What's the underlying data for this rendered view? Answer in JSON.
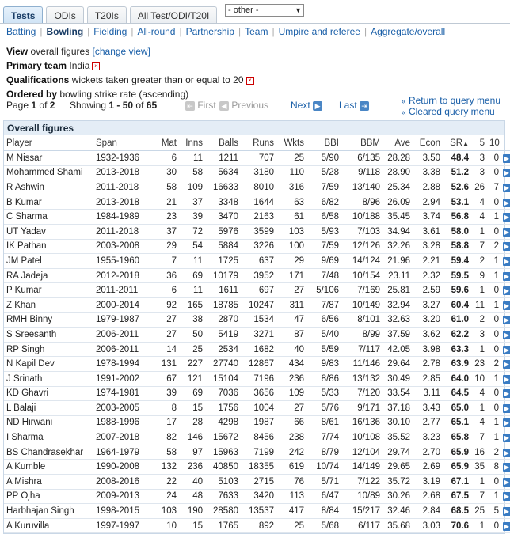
{
  "tabs": [
    {
      "label": "Tests",
      "active": true
    },
    {
      "label": "ODIs",
      "active": false
    },
    {
      "label": "T20Is",
      "active": false
    },
    {
      "label": "All Test/ODI/T20I",
      "active": false
    }
  ],
  "other_select": "- other -",
  "subnav": [
    {
      "label": "Batting",
      "active": false
    },
    {
      "label": "Bowling",
      "active": true
    },
    {
      "label": "Fielding",
      "active": false
    },
    {
      "label": "All-round",
      "active": false
    },
    {
      "label": "Partnership",
      "active": false
    },
    {
      "label": "Team",
      "active": false
    },
    {
      "label": "Umpire and referee",
      "active": false
    },
    {
      "label": "Aggregate/overall",
      "active": false
    }
  ],
  "info": {
    "view_label": "View",
    "view_value": "overall figures",
    "change_view": "[change view]",
    "primary_label": "Primary team",
    "primary_value": "India",
    "qual_label": "Qualifications",
    "qual_value": "wickets taken greater than or equal to 20",
    "order_label": "Ordered by",
    "order_value": "bowling strike rate (ascending)"
  },
  "pager": {
    "page_word": "Page",
    "page_num": "1",
    "of_word": "of",
    "page_total": "2",
    "showing_word": "Showing",
    "showing_range": "1 - 50",
    "showing_of": "of",
    "showing_total": "65",
    "first": "First",
    "previous": "Previous",
    "next": "Next",
    "last": "Last",
    "return_link": "Return to query menu",
    "cleared_link": "Cleared query menu"
  },
  "table": {
    "title": "Overall figures",
    "columns": [
      "Player",
      "Span",
      "Mat",
      "Inns",
      "Balls",
      "Runs",
      "Wkts",
      "BBI",
      "BBM",
      "Ave",
      "Econ",
      "SR",
      "5",
      "10"
    ],
    "rows": [
      [
        "M Nissar",
        "1932-1936",
        "6",
        "11",
        "1211",
        "707",
        "25",
        "5/90",
        "6/135",
        "28.28",
        "3.50",
        "48.4",
        "3",
        "0"
      ],
      [
        "Mohammed Shami",
        "2013-2018",
        "30",
        "58",
        "5634",
        "3180",
        "110",
        "5/28",
        "9/118",
        "28.90",
        "3.38",
        "51.2",
        "3",
        "0"
      ],
      [
        "R Ashwin",
        "2011-2018",
        "58",
        "109",
        "16633",
        "8010",
        "316",
        "7/59",
        "13/140",
        "25.34",
        "2.88",
        "52.6",
        "26",
        "7"
      ],
      [
        "B Kumar",
        "2013-2018",
        "21",
        "37",
        "3348",
        "1644",
        "63",
        "6/82",
        "8/96",
        "26.09",
        "2.94",
        "53.1",
        "4",
        "0"
      ],
      [
        "C Sharma",
        "1984-1989",
        "23",
        "39",
        "3470",
        "2163",
        "61",
        "6/58",
        "10/188",
        "35.45",
        "3.74",
        "56.8",
        "4",
        "1"
      ],
      [
        "UT Yadav",
        "2011-2018",
        "37",
        "72",
        "5976",
        "3599",
        "103",
        "5/93",
        "7/103",
        "34.94",
        "3.61",
        "58.0",
        "1",
        "0"
      ],
      [
        "IK Pathan",
        "2003-2008",
        "29",
        "54",
        "5884",
        "3226",
        "100",
        "7/59",
        "12/126",
        "32.26",
        "3.28",
        "58.8",
        "7",
        "2"
      ],
      [
        "JM Patel",
        "1955-1960",
        "7",
        "11",
        "1725",
        "637",
        "29",
        "9/69",
        "14/124",
        "21.96",
        "2.21",
        "59.4",
        "2",
        "1"
      ],
      [
        "RA Jadeja",
        "2012-2018",
        "36",
        "69",
        "10179",
        "3952",
        "171",
        "7/48",
        "10/154",
        "23.11",
        "2.32",
        "59.5",
        "9",
        "1"
      ],
      [
        "P Kumar",
        "2011-2011",
        "6",
        "11",
        "1611",
        "697",
        "27",
        "5/106",
        "7/169",
        "25.81",
        "2.59",
        "59.6",
        "1",
        "0"
      ],
      [
        "Z Khan",
        "2000-2014",
        "92",
        "165",
        "18785",
        "10247",
        "311",
        "7/87",
        "10/149",
        "32.94",
        "3.27",
        "60.4",
        "11",
        "1"
      ],
      [
        "RMH Binny",
        "1979-1987",
        "27",
        "38",
        "2870",
        "1534",
        "47",
        "6/56",
        "8/101",
        "32.63",
        "3.20",
        "61.0",
        "2",
        "0"
      ],
      [
        "S Sreesanth",
        "2006-2011",
        "27",
        "50",
        "5419",
        "3271",
        "87",
        "5/40",
        "8/99",
        "37.59",
        "3.62",
        "62.2",
        "3",
        "0"
      ],
      [
        "RP Singh",
        "2006-2011",
        "14",
        "25",
        "2534",
        "1682",
        "40",
        "5/59",
        "7/117",
        "42.05",
        "3.98",
        "63.3",
        "1",
        "0"
      ],
      [
        "N Kapil Dev",
        "1978-1994",
        "131",
        "227",
        "27740",
        "12867",
        "434",
        "9/83",
        "11/146",
        "29.64",
        "2.78",
        "63.9",
        "23",
        "2"
      ],
      [
        "J Srinath",
        "1991-2002",
        "67",
        "121",
        "15104",
        "7196",
        "236",
        "8/86",
        "13/132",
        "30.49",
        "2.85",
        "64.0",
        "10",
        "1"
      ],
      [
        "KD Ghavri",
        "1974-1981",
        "39",
        "69",
        "7036",
        "3656",
        "109",
        "5/33",
        "7/120",
        "33.54",
        "3.11",
        "64.5",
        "4",
        "0"
      ],
      [
        "L Balaji",
        "2003-2005",
        "8",
        "15",
        "1756",
        "1004",
        "27",
        "5/76",
        "9/171",
        "37.18",
        "3.43",
        "65.0",
        "1",
        "0"
      ],
      [
        "ND Hirwani",
        "1988-1996",
        "17",
        "28",
        "4298",
        "1987",
        "66",
        "8/61",
        "16/136",
        "30.10",
        "2.77",
        "65.1",
        "4",
        "1"
      ],
      [
        "I Sharma",
        "2007-2018",
        "82",
        "146",
        "15672",
        "8456",
        "238",
        "7/74",
        "10/108",
        "35.52",
        "3.23",
        "65.8",
        "7",
        "1"
      ],
      [
        "BS Chandrasekhar",
        "1964-1979",
        "58",
        "97",
        "15963",
        "7199",
        "242",
        "8/79",
        "12/104",
        "29.74",
        "2.70",
        "65.9",
        "16",
        "2"
      ],
      [
        "A Kumble",
        "1990-2008",
        "132",
        "236",
        "40850",
        "18355",
        "619",
        "10/74",
        "14/149",
        "29.65",
        "2.69",
        "65.9",
        "35",
        "8"
      ],
      [
        "A Mishra",
        "2008-2016",
        "22",
        "40",
        "5103",
        "2715",
        "76",
        "5/71",
        "7/122",
        "35.72",
        "3.19",
        "67.1",
        "1",
        "0"
      ],
      [
        "PP Ojha",
        "2009-2013",
        "24",
        "48",
        "7633",
        "3420",
        "113",
        "6/47",
        "10/89",
        "30.26",
        "2.68",
        "67.5",
        "7",
        "1"
      ],
      [
        "Harbhajan Singh",
        "1998-2015",
        "103",
        "190",
        "28580",
        "13537",
        "417",
        "8/84",
        "15/217",
        "32.46",
        "2.84",
        "68.5",
        "25",
        "5"
      ],
      [
        "A Kuruvilla",
        "1997-1997",
        "10",
        "15",
        "1765",
        "892",
        "25",
        "5/68",
        "6/117",
        "35.68",
        "3.03",
        "70.6",
        "1",
        "0"
      ]
    ]
  },
  "colors": {
    "link": "#1a5fa8",
    "header_bg": "#e4edf6",
    "button": "#3a7cc3"
  }
}
